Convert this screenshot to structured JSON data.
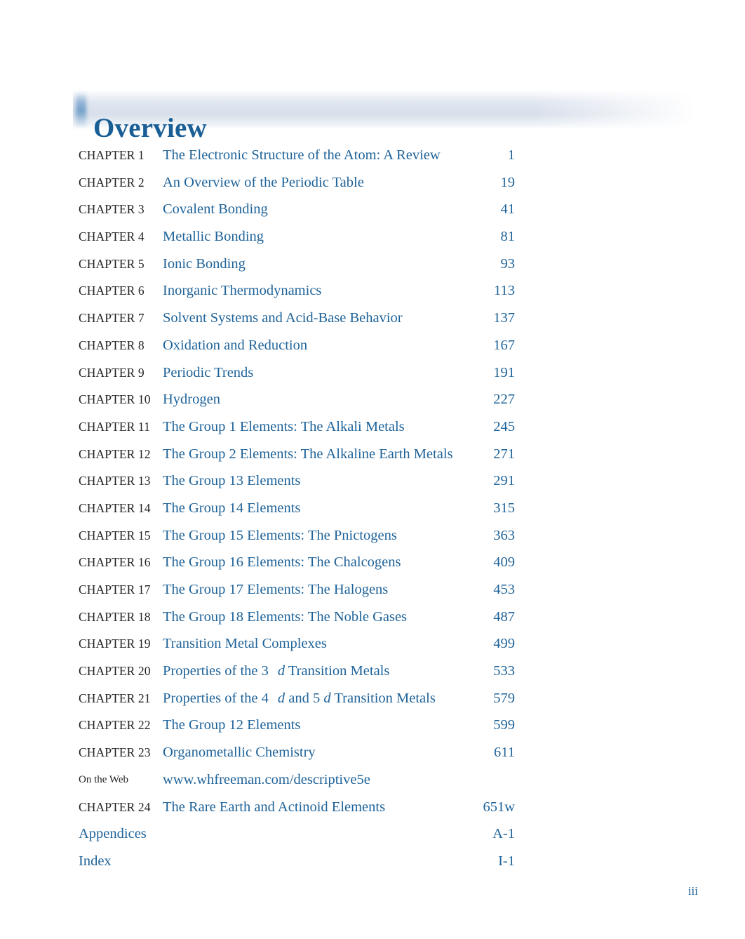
{
  "header": {
    "title": "Overview",
    "accent_color": "#1a5e96",
    "band_color": "#d7dfea"
  },
  "colors": {
    "title_blue": "#1f6399",
    "label_dark": "#232323"
  },
  "toc": {
    "rows": [
      {
        "label": "CHAPTER 1",
        "label_style": "caps",
        "title": "The Electronic Structure of the Atom: A Review",
        "page": "1"
      },
      {
        "label": "CHAPTER 2",
        "label_style": "caps",
        "title": "An Overview of the Periodic Table",
        "page": "19"
      },
      {
        "label": "CHAPTER 3",
        "label_style": "caps",
        "title": "Covalent Bonding",
        "page": "41"
      },
      {
        "label": "CHAPTER 4",
        "label_style": "caps",
        "title": "Metallic Bonding",
        "page": "81"
      },
      {
        "label": "CHAPTER 5",
        "label_style": "caps",
        "title": "Ionic Bonding",
        "page": "93"
      },
      {
        "label": "CHAPTER 6",
        "label_style": "caps",
        "title": "Inorganic Thermodynamics",
        "page": "113"
      },
      {
        "label": "CHAPTER 7",
        "label_style": "caps",
        "title": "Solvent Systems and Acid-Base Behavior",
        "page": "137"
      },
      {
        "label": "CHAPTER 8",
        "label_style": "caps",
        "title": "Oxidation and Reduction",
        "page": "167"
      },
      {
        "label": "CHAPTER 9",
        "label_style": "caps",
        "title": "Periodic Trends",
        "page": "191"
      },
      {
        "label": "CHAPTER 10",
        "label_style": "caps",
        "title": "Hydrogen",
        "page": "227"
      },
      {
        "label": "CHAPTER 11",
        "label_style": "caps",
        "title": "The Group 1 Elements: The Alkali Metals",
        "page": "245"
      },
      {
        "label": "CHAPTER 12",
        "label_style": "caps",
        "title": "The Group 2 Elements: The Alkaline Earth Metals",
        "page": "271"
      },
      {
        "label": "CHAPTER 13",
        "label_style": "caps",
        "title": "The Group 13 Elements",
        "page": "291"
      },
      {
        "label": "CHAPTER 14",
        "label_style": "caps",
        "title": "The Group 14 Elements",
        "page": "315"
      },
      {
        "label": "CHAPTER 15",
        "label_style": "caps",
        "title": "The Group 15 Elements: The Pnictogens",
        "page": "363"
      },
      {
        "label": "CHAPTER 16",
        "label_style": "caps",
        "title": "The Group 16 Elements: The Chalcogens",
        "page": "409"
      },
      {
        "label": "CHAPTER 17",
        "label_style": "caps",
        "title": "The Group 17 Elements: The Halogens",
        "page": "453"
      },
      {
        "label": "CHAPTER 18",
        "label_style": "caps",
        "title": "The Group 18 Elements: The Noble Gases",
        "page": "487"
      },
      {
        "label": "CHAPTER 19",
        "label_style": "caps",
        "title": "Transition Metal Complexes",
        "page": "499"
      },
      {
        "label": "CHAPTER 20",
        "label_style": "caps",
        "title": "Properties of the 3 d Transition Metals",
        "title_html": "Properties of the 3<span class=\"gap\"></span><span class=\"ital\">d</span> Transition Metals",
        "page": "533"
      },
      {
        "label": "CHAPTER 21",
        "label_style": "caps",
        "title": "Properties of the 4 d and 5 d Transition Metals",
        "title_html": "Properties of the 4<span class=\"gap\"></span><span class=\"ital\">d</span> and 5 <span class=\"ital\">d</span> Transition Metals",
        "page": "579"
      },
      {
        "label": "CHAPTER 22",
        "label_style": "caps",
        "title": "The Group 12 Elements",
        "page": "599"
      },
      {
        "label": "CHAPTER 23",
        "label_style": "caps",
        "title": "Organometallic Chemistry",
        "page": "611"
      },
      {
        "label": "On the Web",
        "label_style": "plain",
        "title": "www.whfreeman.com/descriptive5e",
        "page": ""
      },
      {
        "label": "CHAPTER 24",
        "label_style": "caps",
        "title": "The Rare Earth and Actinoid Elements",
        "page": "651w"
      },
      {
        "label": "",
        "label_style": "plain",
        "title": "Appendices",
        "title_at_margin": true,
        "page": "A-1"
      },
      {
        "label": "",
        "label_style": "plain",
        "title": "Index",
        "title_at_margin": true,
        "page": "I-1"
      }
    ]
  },
  "footer": {
    "folio": "iii"
  }
}
